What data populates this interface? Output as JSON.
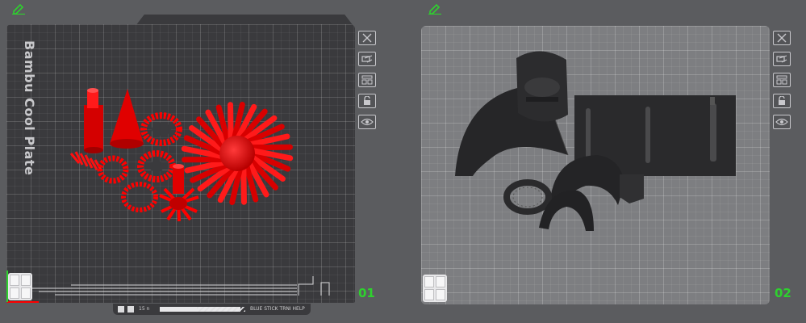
{
  "plates": [
    {
      "name": "Bambu Cool Plate",
      "number": "01",
      "model_color": "#ff0000"
    },
    {
      "name": "",
      "number": "02",
      "model_color": "#2a2a2c"
    }
  ],
  "toolbar_icons": [
    "close-icon",
    "arrange-icon",
    "layout-icon",
    "lock-icon",
    "eye-icon"
  ],
  "bottom_strip": {
    "left_text": "15 n",
    "right_text": "BLUE STICK TRNI HELP"
  },
  "colors": {
    "background": "#5b5c5f",
    "plate_dark": "#3a3a3d",
    "plate_light": "#7d7e81",
    "accent_green": "#2ed12e",
    "red_model": "#ff0000"
  }
}
